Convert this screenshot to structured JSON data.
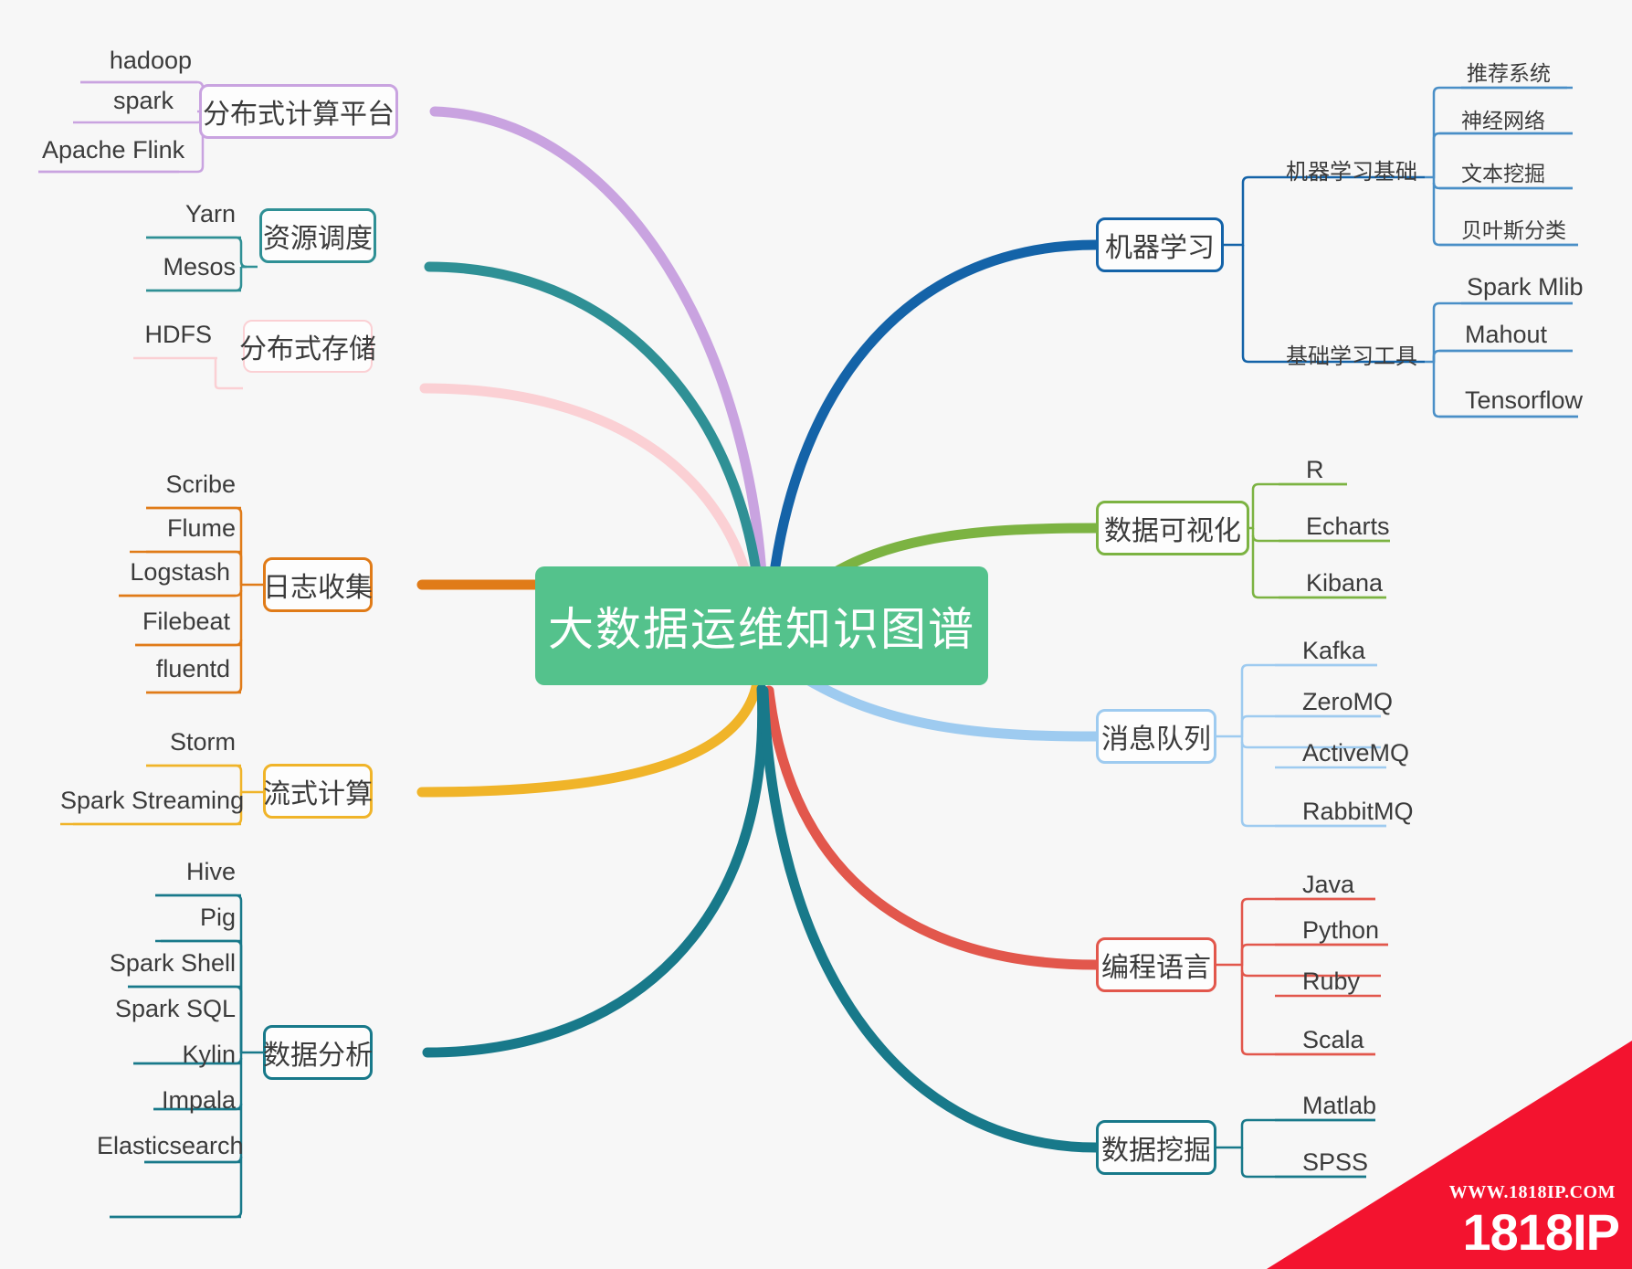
{
  "title": "大数据运维知识图谱",
  "center": {
    "label": "大数据运维知识图谱",
    "color": "#54c28c",
    "text_color": "#ffffff"
  },
  "watermark": {
    "url": "WWW.1818IP.COM",
    "name": "1818IP",
    "color": "#f3132f"
  },
  "branches": {
    "left": [
      {
        "label": "分布式计算平台",
        "color": "#c9a3e0",
        "children": [
          {
            "label": "hadoop"
          },
          {
            "label": "spark"
          },
          {
            "label": "Apache Flink"
          }
        ]
      },
      {
        "label": "资源调度",
        "color": "#2f9095",
        "children": [
          {
            "label": "Yarn"
          },
          {
            "label": "Mesos"
          }
        ]
      },
      {
        "label": "分布式存储",
        "color": "#fbd0d4",
        "children": [
          {
            "label": "HDFS"
          }
        ]
      },
      {
        "label": "日志收集",
        "color": "#e07b18",
        "children": [
          {
            "label": "Scribe"
          },
          {
            "label": "Flume"
          },
          {
            "label": "Logstash"
          },
          {
            "label": "Filebeat"
          },
          {
            "label": "fluentd"
          }
        ]
      },
      {
        "label": "流式计算",
        "color": "#f0b429",
        "children": [
          {
            "label": "Storm"
          },
          {
            "label": "Spark  Streaming"
          }
        ]
      },
      {
        "label": "数据分析",
        "color": "#18798a",
        "children": [
          {
            "label": "Hive"
          },
          {
            "label": "Pig"
          },
          {
            "label": "Spark Shell"
          },
          {
            "label": "Spark SQL"
          },
          {
            "label": "Kylin"
          },
          {
            "label": "Impala"
          },
          {
            "label": "Elasticsearch"
          }
        ]
      }
    ],
    "right": [
      {
        "label": "机器学习",
        "color": "#1463a8",
        "groups": [
          {
            "label": "机器学习基础",
            "children": [
              {
                "label": "推荐系统"
              },
              {
                "label": "神经网络"
              },
              {
                "label": "文本挖掘"
              },
              {
                "label": "贝叶斯分类"
              }
            ]
          },
          {
            "label": "基础学习工具",
            "children": [
              {
                "label": "Spark Mlib"
              },
              {
                "label": "Mahout"
              },
              {
                "label": "Tensorflow"
              }
            ]
          }
        ]
      },
      {
        "label": "数据可视化",
        "color": "#7cb342",
        "children": [
          {
            "label": "R"
          },
          {
            "label": "Echarts"
          },
          {
            "label": "Kibana"
          }
        ]
      },
      {
        "label": "消息队列",
        "color": "#9ecbf0",
        "children": [
          {
            "label": "Kafka"
          },
          {
            "label": "ZeroMQ"
          },
          {
            "label": "ActiveMQ"
          },
          {
            "label": "RabbitMQ"
          }
        ]
      },
      {
        "label": "编程语言",
        "color": "#e2574c",
        "children": [
          {
            "label": "Java"
          },
          {
            "label": "Python"
          },
          {
            "label": "Ruby"
          },
          {
            "label": "Scala"
          }
        ]
      },
      {
        "label": "数据挖掘",
        "color": "#18798a",
        "children": [
          {
            "label": "Matlab"
          },
          {
            "label": "SPSS"
          }
        ]
      }
    ]
  }
}
